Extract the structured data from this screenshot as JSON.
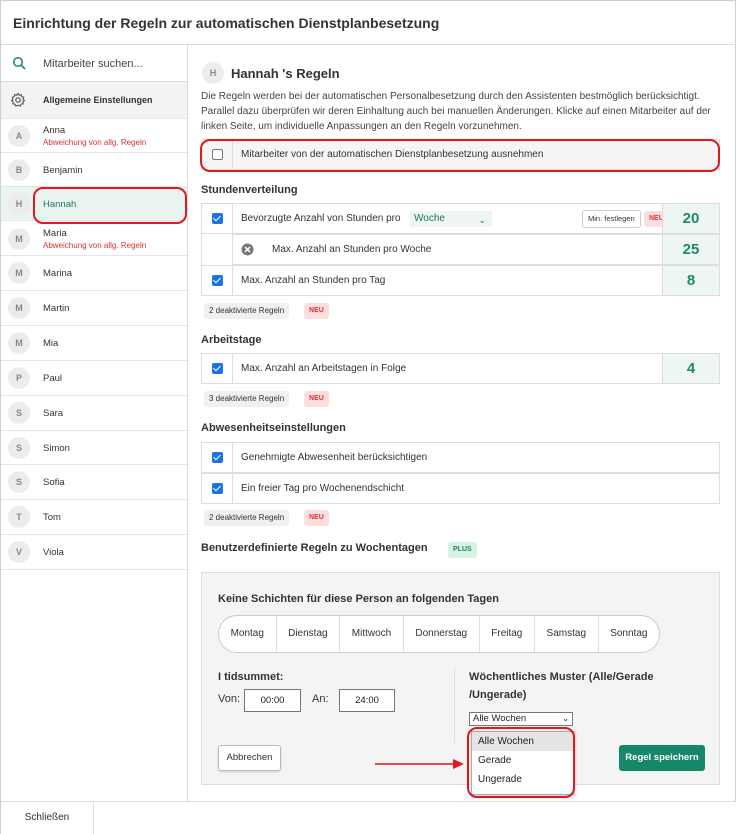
{
  "header": {
    "title": "Einrichtung der Regeln zur automatischen Dienstplanbesetzung"
  },
  "sidebar": {
    "search_placeholder": "Mitarbeiter suchen...",
    "settings_label": "Allgemeine Einstellungen",
    "employees": [
      {
        "initial": "A",
        "name": "Anna",
        "deviation": "Abweichung von allg. Regeln"
      },
      {
        "initial": "B",
        "name": "Benjamin",
        "deviation": ""
      },
      {
        "initial": "H",
        "name": "Hannah",
        "deviation": ""
      },
      {
        "initial": "M",
        "name": "Maria",
        "deviation": "Abweichung von allg. Regeln"
      },
      {
        "initial": "M",
        "name": "Marina",
        "deviation": ""
      },
      {
        "initial": "M",
        "name": "Martin",
        "deviation": ""
      },
      {
        "initial": "M",
        "name": "Mia",
        "deviation": ""
      },
      {
        "initial": "P",
        "name": "Paul",
        "deviation": ""
      },
      {
        "initial": "S",
        "name": "Sara",
        "deviation": ""
      },
      {
        "initial": "S",
        "name": "Simon",
        "deviation": ""
      },
      {
        "initial": "S",
        "name": "Sofia",
        "deviation": ""
      },
      {
        "initial": "T",
        "name": "Tom",
        "deviation": ""
      },
      {
        "initial": "V",
        "name": "Viola",
        "deviation": ""
      }
    ],
    "selected": "Hannah"
  },
  "main": {
    "avatar_initial": "H",
    "title": "Hannah 's Regeln",
    "description": "Die Regeln werden bei der automatischen Personalbesetzung durch den Assistenten bestmöglich berücksichtigt. Parallel dazu überprüfen wir deren Einhaltung auch bei manuellen Änderungen. Klicke auf einen Mitarbeiter auf der linken Seite, um individuelle Anpassungen an den Regeln vorzunehmen.",
    "exclude_label": "Mitarbeiter von der automatischen Dienstplanbesetzung ausnehmen",
    "stunden": {
      "heading": "Stundenverteilung",
      "preferred_label": "Bevorzugte Anzahl von Stunden pro",
      "period_select": "Woche",
      "min_button": "Min. festlegen",
      "neu": "NEU",
      "preferred_value": "20",
      "max_week_label": "Max. Anzahl an Stunden pro Woche",
      "max_week_value": "25",
      "max_day_label": "Max. Anzahl an Stunden pro Tag",
      "max_day_value": "8",
      "deactivated": "2 deaktivierte Regeln"
    },
    "arbeitstage": {
      "heading": "Arbeitstage",
      "max_days_label": "Max. Anzahl an Arbeitstagen in Folge",
      "max_days_value": "4",
      "deactivated": "3 deaktivierte Regeln"
    },
    "abwesenheit": {
      "heading": "Abwesenheitseinstellungen",
      "approved_label": "Genehmigte Abwesenheit berücksichtigen",
      "free_day_label": "Ein freier Tag pro Wochenendschicht",
      "deactivated": "2 deaktivierte Regeln"
    },
    "custom": {
      "heading": "Benutzerdefinierte Regeln zu Wochentagen",
      "plus": "PLUS",
      "panel_title": "Keine Schichten für diese Person an folgenden Tagen",
      "days": [
        "Montag",
        "Dienstag",
        "Mittwoch",
        "Donnerstag",
        "Freitag",
        "Samstag",
        "Sonntag"
      ],
      "time_label": "I tidsummet:",
      "from_label": "Von:",
      "from_value": "00:00",
      "to_label": "An:",
      "to_value": "24:00",
      "pattern_label_1": "Wöchentliches Muster (Alle/Gerade",
      "pattern_label_2": "/Ungerade)",
      "pattern_selected": "Alle Wochen",
      "pattern_options": [
        "Alle Wochen",
        "Gerade",
        "Ungerade"
      ],
      "cancel": "Abbrechen",
      "save": "Regel speichern"
    }
  },
  "footer": {
    "close": "Schließen"
  },
  "colors": {
    "accent": "#17876a",
    "check": "#1a73e8",
    "highlight": "#e0181f",
    "neu": "#e03030"
  }
}
